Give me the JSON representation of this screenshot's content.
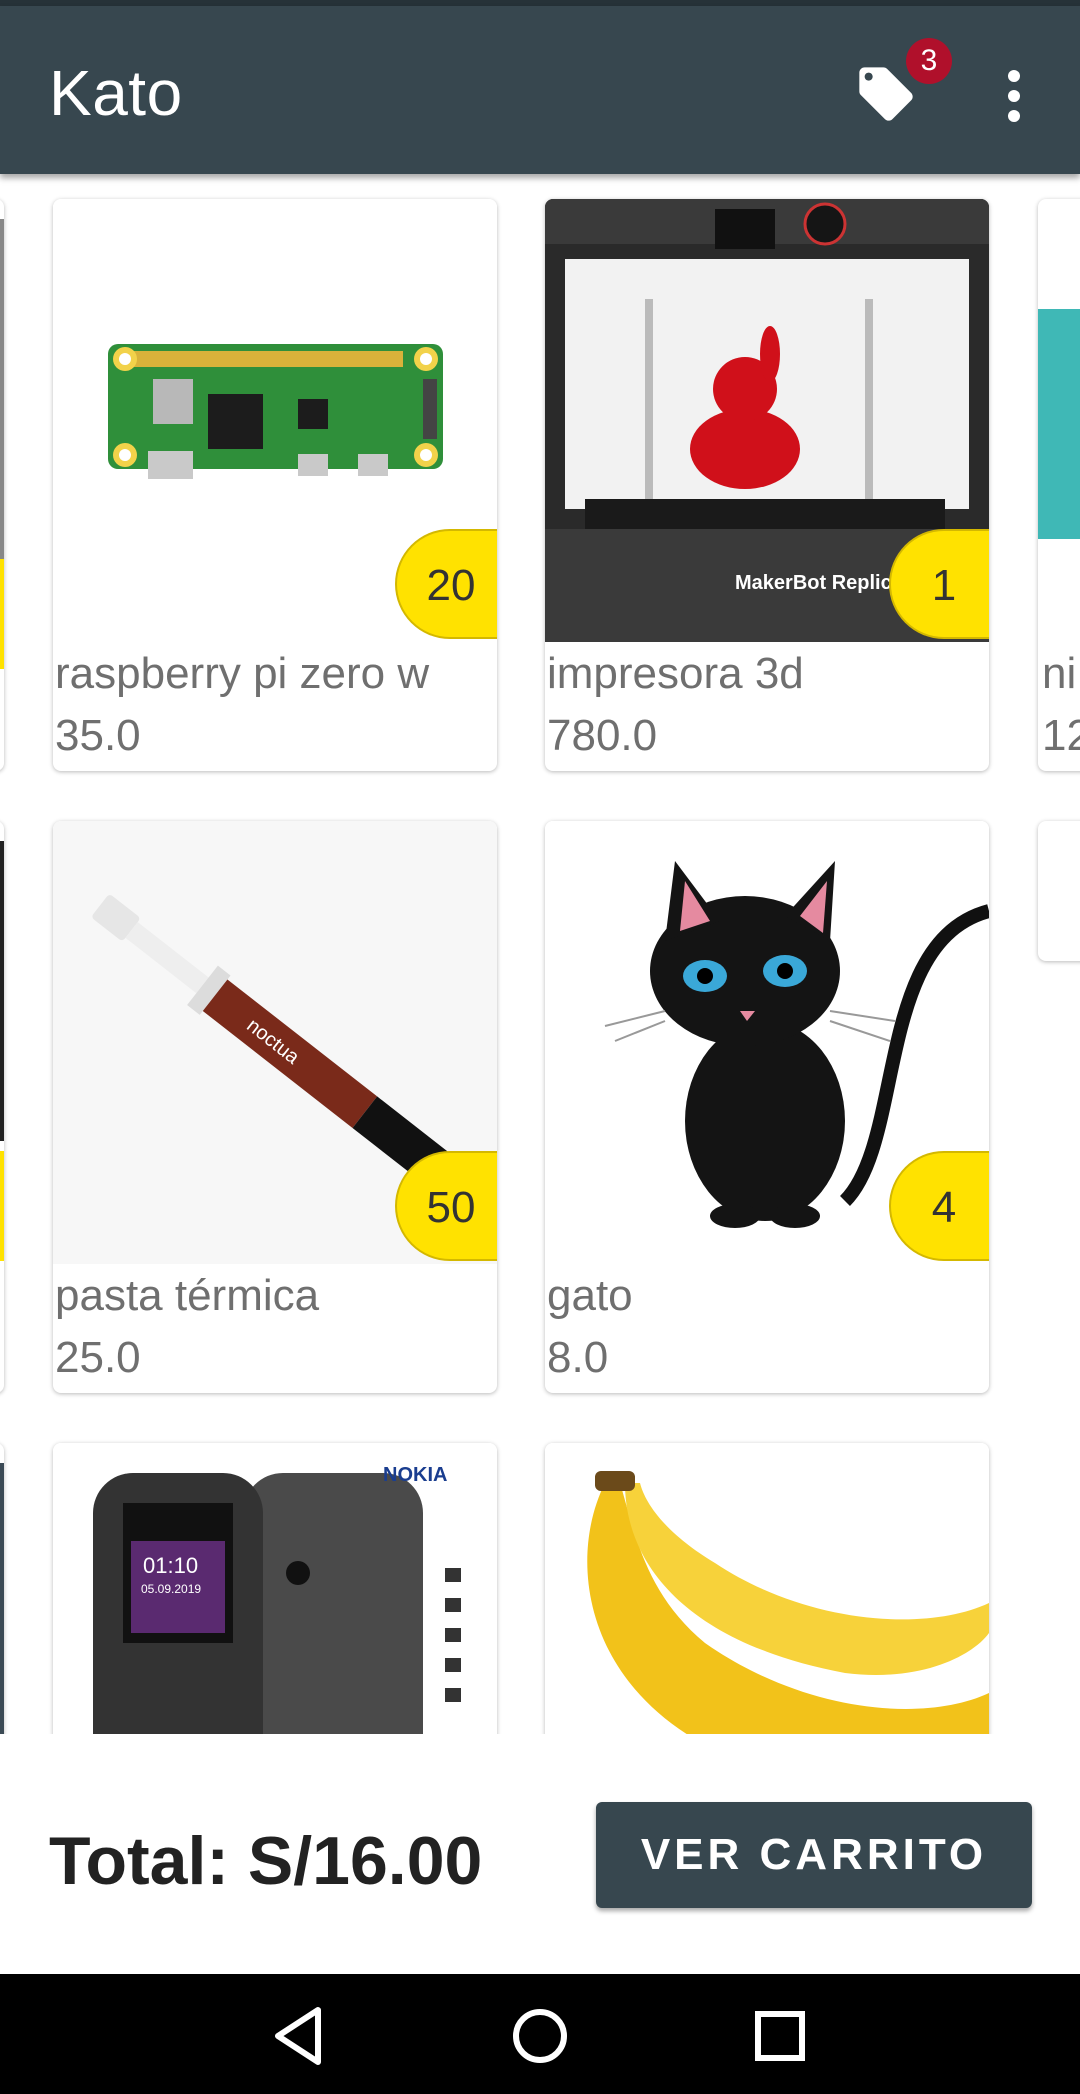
{
  "app": {
    "title": "Kato",
    "cart_badge": "3"
  },
  "products": [
    {
      "name": "raspberry pi zero w",
      "price": "35.0",
      "qty": "20"
    },
    {
      "name": "impresora 3d",
      "price": "780.0",
      "qty": "1"
    },
    {
      "name": "pasta térmica",
      "price": "25.0",
      "qty": "50"
    },
    {
      "name": "gato",
      "price": "8.0",
      "qty": "4"
    }
  ],
  "partial_products": [
    {
      "name_fragment": "ni",
      "price_fragment": "12"
    }
  ],
  "nokia_brand": "NOKIA",
  "nokia_time": "01:10",
  "nokia_date": "05.09.2019",
  "printer_brand": "MakerBot Replicator",
  "footer": {
    "total_label": "Total: S/16.00",
    "cart_button": "VER CARRITO"
  },
  "icons": [
    "tag-icon",
    "more-vert-icon",
    "back-icon",
    "home-icon",
    "recents-icon"
  ],
  "colors": {
    "appbar": "#37474f",
    "badge": "#b0102b",
    "qty_badge": "#ffe200",
    "button": "#37474f"
  }
}
